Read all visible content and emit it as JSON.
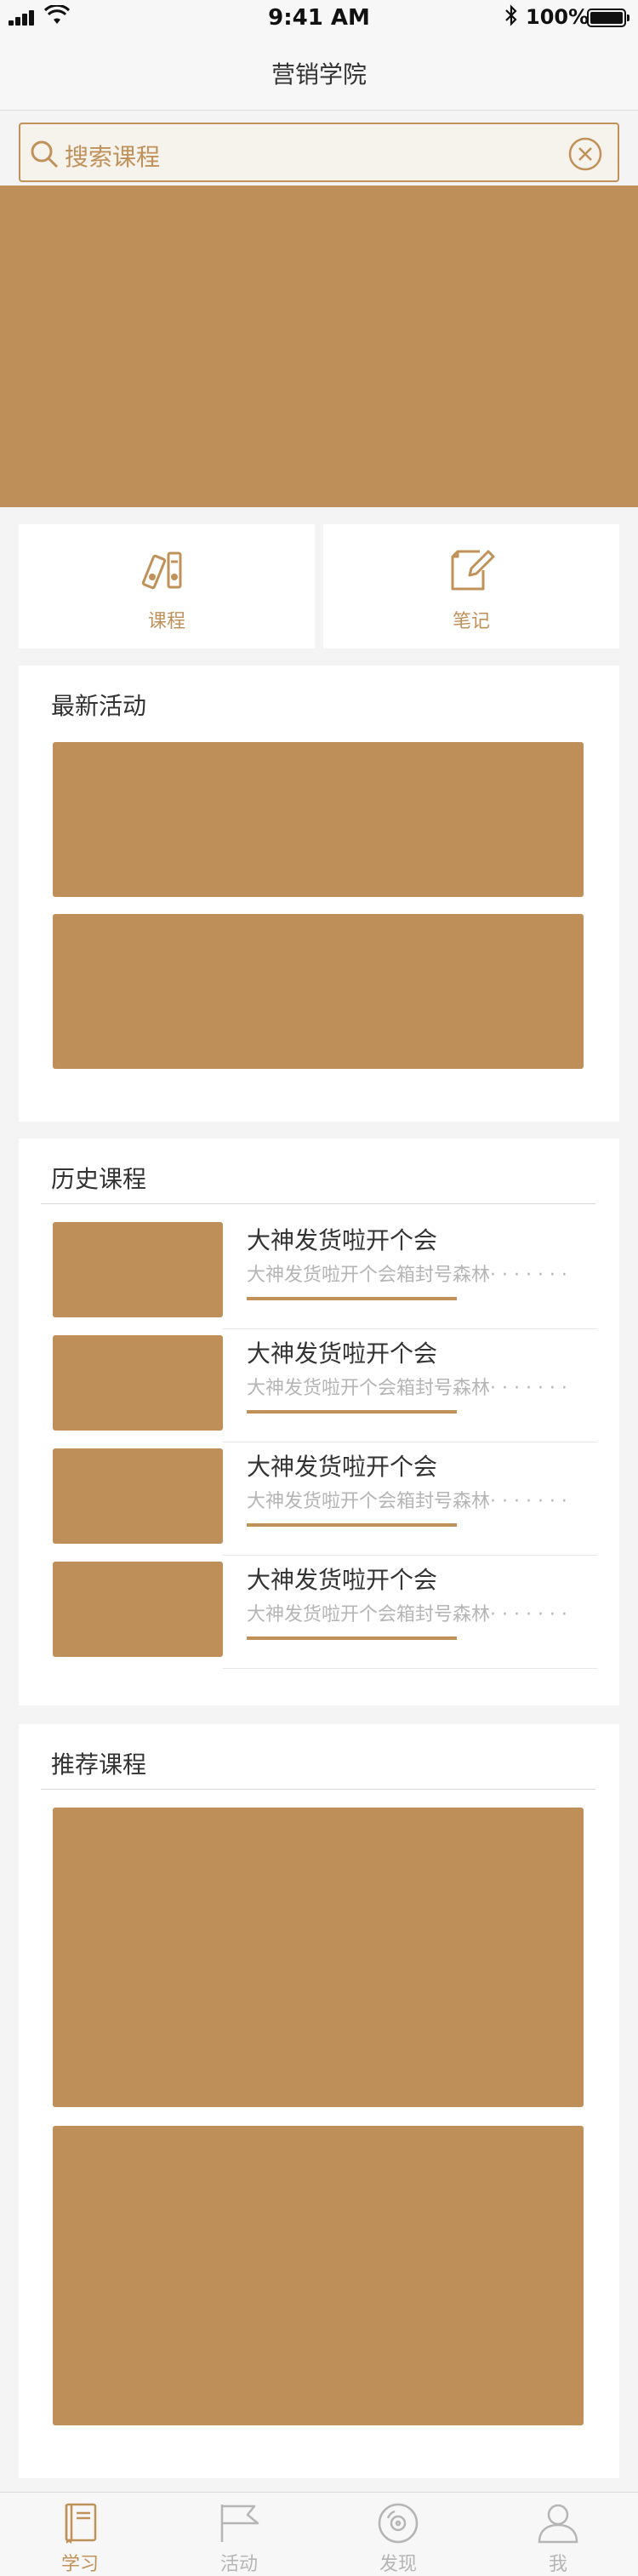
{
  "status_bar": {
    "time": "9:41 AM",
    "battery": "100%"
  },
  "nav": {
    "title": "营销学院"
  },
  "search": {
    "placeholder": "搜索课程"
  },
  "quick_entries": [
    {
      "label": "课程",
      "icon": "folders-icon"
    },
    {
      "label": "笔记",
      "icon": "note-edit-icon"
    }
  ],
  "latest_activities": {
    "title": "最新活动"
  },
  "history_courses": {
    "title": "历史课程",
    "items": [
      {
        "title": "大神发货啦开个会",
        "desc": "大神发货啦开个会箱封号森林· · · · · · ·",
        "progress": 0.6
      },
      {
        "title": "大神发货啦开个会",
        "desc": "大神发货啦开个会箱封号森林· · · · · · ·",
        "progress": 0.6
      },
      {
        "title": "大神发货啦开个会",
        "desc": "大神发货啦开个会箱封号森林· · · · · · ·",
        "progress": 0.6
      },
      {
        "title": "大神发货啦开个会",
        "desc": "大神发货啦开个会箱封号森林· · · · · · ·",
        "progress": 0.6
      }
    ]
  },
  "recommended_courses": {
    "title": "推荐课程"
  },
  "tab_bar": {
    "tabs": [
      {
        "label": "学习",
        "icon": "book-icon",
        "active": true
      },
      {
        "label": "活动",
        "icon": "flag-icon",
        "active": false
      },
      {
        "label": "发现",
        "icon": "disc-icon",
        "active": false
      },
      {
        "label": "我",
        "icon": "person-icon",
        "active": false
      }
    ]
  },
  "colors": {
    "accent": "#c09158",
    "placeholder_block": "#bf8f59",
    "inactive_tab": "#b5b5b5"
  }
}
